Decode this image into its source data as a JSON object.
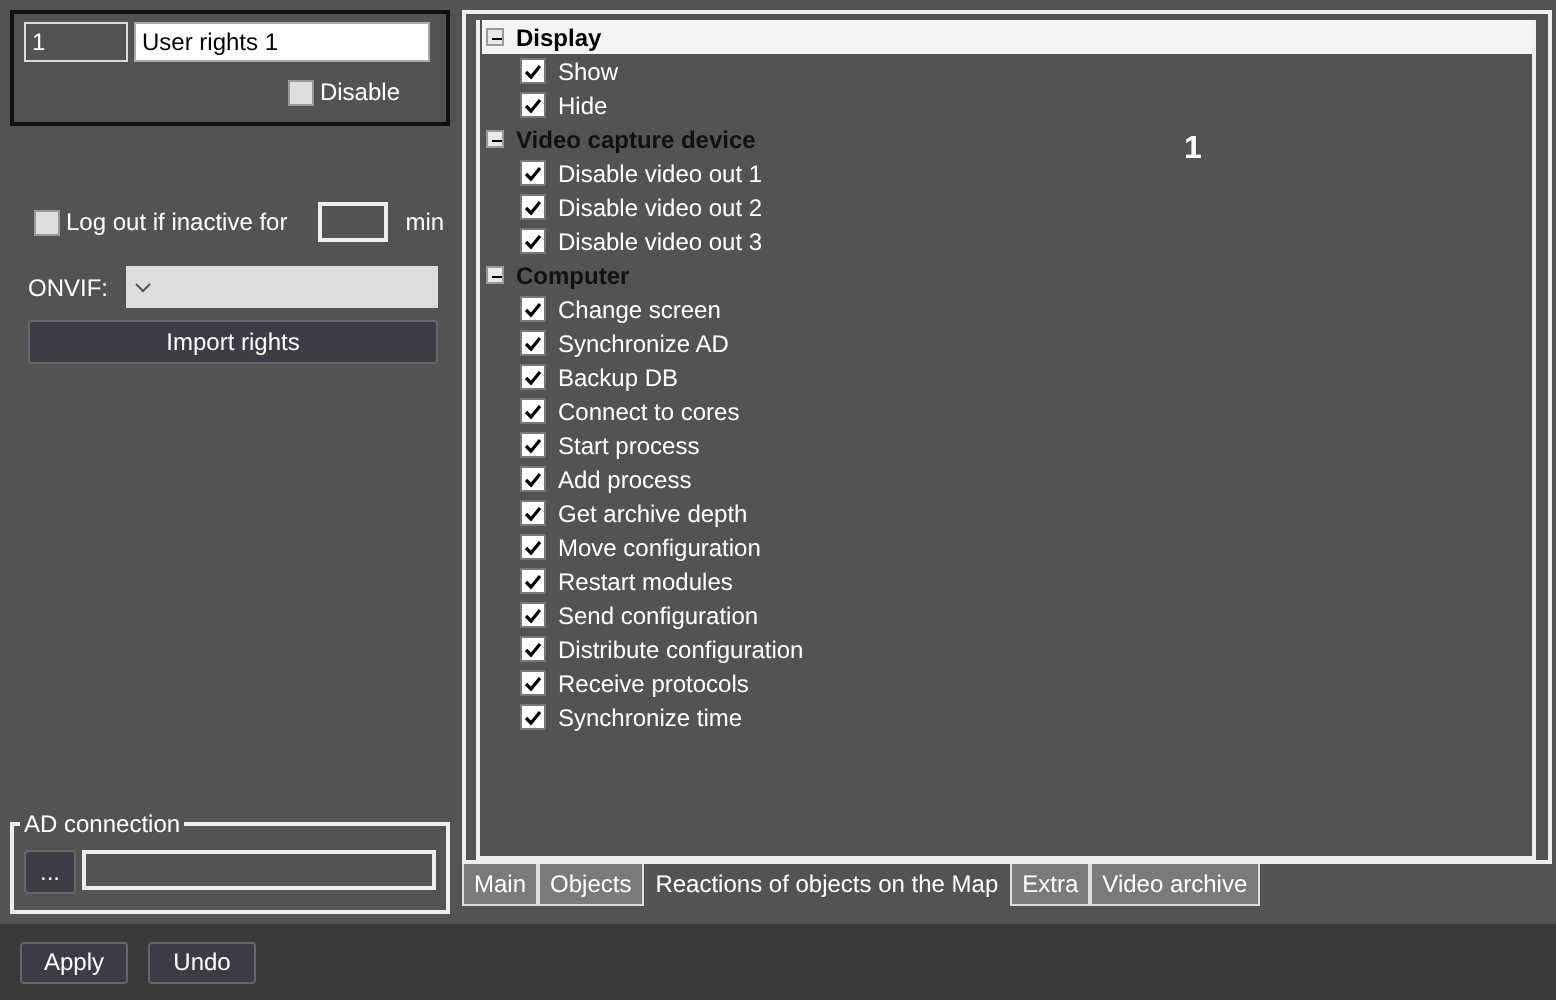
{
  "rights": {
    "id": "1",
    "name": "User rights 1",
    "disable": {
      "label": "Disable",
      "checked": false
    }
  },
  "logout": {
    "label": "Log out if inactive for",
    "checked": false,
    "unit": "min"
  },
  "onvif": {
    "label": "ONVIF:"
  },
  "import_button": "Import rights",
  "ad_connection": {
    "title": "AD connection",
    "browse_button": "..."
  },
  "tree": [
    {
      "label": "Display",
      "expanded": true,
      "selected": true,
      "children": [
        {
          "label": "Show",
          "checked": true
        },
        {
          "label": "Hide",
          "checked": true
        }
      ]
    },
    {
      "label": "Video capture device",
      "expanded": true,
      "selected": false,
      "children": [
        {
          "label": "Disable video out 1",
          "checked": true
        },
        {
          "label": "Disable video out 2",
          "checked": true
        },
        {
          "label": "Disable video out 3",
          "checked": true
        }
      ]
    },
    {
      "label": "Computer",
      "expanded": true,
      "selected": false,
      "children": [
        {
          "label": "Change screen",
          "checked": true
        },
        {
          "label": "Synchronize AD",
          "checked": true
        },
        {
          "label": "Backup DB",
          "checked": true
        },
        {
          "label": "Connect to cores",
          "checked": true
        },
        {
          "label": "Start process",
          "checked": true
        },
        {
          "label": "Add process",
          "checked": true
        },
        {
          "label": "Get archive depth",
          "checked": true
        },
        {
          "label": "Move configuration",
          "checked": true
        },
        {
          "label": "Restart modules",
          "checked": true
        },
        {
          "label": "Send configuration",
          "checked": true
        },
        {
          "label": "Distribute configuration",
          "checked": true
        },
        {
          "label": "Receive protocols",
          "checked": true
        },
        {
          "label": "Synchronize time",
          "checked": true
        }
      ]
    }
  ],
  "callout": "1",
  "tabs": [
    {
      "label": "Main",
      "selected": false
    },
    {
      "label": "Objects",
      "selected": false
    },
    {
      "label": "Reactions of objects on the Map",
      "selected": true
    },
    {
      "label": "Extra",
      "selected": false
    },
    {
      "label": "Video archive",
      "selected": false
    }
  ],
  "buttons": [
    "Apply",
    "Undo"
  ]
}
